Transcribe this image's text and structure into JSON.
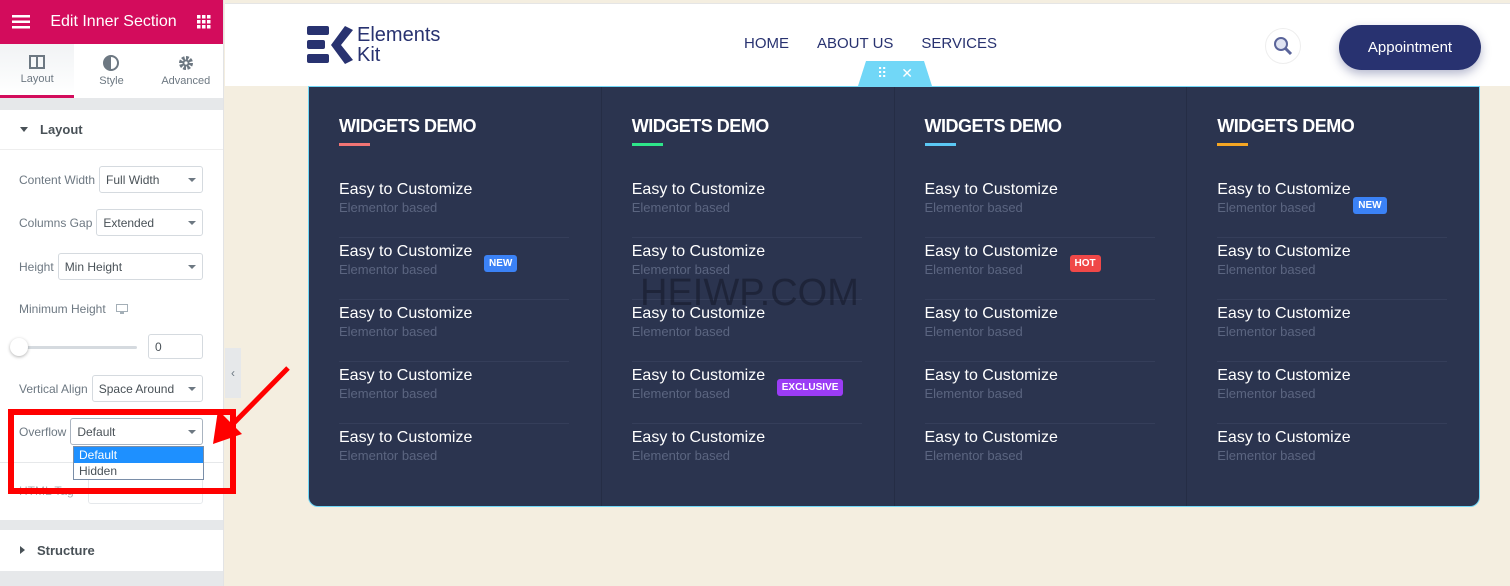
{
  "sidebar": {
    "title": "Edit Inner Section",
    "tabs": [
      {
        "label": "Layout",
        "icon": "columns-icon"
      },
      {
        "label": "Style",
        "icon": "contrast-icon"
      },
      {
        "label": "Advanced",
        "icon": "gear-icon"
      }
    ],
    "section_layout": "Layout",
    "controls": {
      "content_width": {
        "label": "Content Width",
        "value": "Full Width"
      },
      "columns_gap": {
        "label": "Columns Gap",
        "value": "Extended"
      },
      "height": {
        "label": "Height",
        "value": "Min Height"
      },
      "min_height": {
        "label": "Minimum Height",
        "value": "0"
      },
      "vertical_align": {
        "label": "Vertical Align",
        "value": "Space Around"
      },
      "overflow": {
        "label": "Overflow",
        "value": "Default",
        "options": [
          "Default",
          "Hidden"
        ]
      },
      "html_tag": {
        "label": "HTML Tag"
      }
    },
    "section_structure": "Structure"
  },
  "header": {
    "logo": "Elements Kit",
    "logo_lines": [
      "Elements",
      "Kit"
    ],
    "nav": [
      "HOME",
      "ABOUT US",
      "SERVICES"
    ],
    "appointment": "Appointment"
  },
  "menu": {
    "columns": [
      {
        "heading": "WIDGETS DEMO",
        "accent": "#f27474",
        "items": [
          {
            "title": "Easy to Customize",
            "sub": "Elementor based"
          },
          {
            "title": "Easy to Customize",
            "sub": "Elementor based",
            "badge": "NEW"
          },
          {
            "title": "Easy to Customize",
            "sub": "Elementor based"
          },
          {
            "title": "Easy to Customize",
            "sub": "Elementor based"
          },
          {
            "title": "Easy to Customize",
            "sub": "Elementor based"
          }
        ]
      },
      {
        "heading": "WIDGETS DEMO",
        "accent": "#2ee68a",
        "items": [
          {
            "title": "Easy to Customize",
            "sub": "Elementor based"
          },
          {
            "title": "Easy to Customize",
            "sub": "Elementor based"
          },
          {
            "title": "Easy to Customize",
            "sub": "Elementor based"
          },
          {
            "title": "Easy to Customize",
            "sub": "Elementor based",
            "badge": "EXCLUSIVE"
          },
          {
            "title": "Easy to Customize",
            "sub": "Elementor based"
          }
        ]
      },
      {
        "heading": "WIDGETS DEMO",
        "accent": "#5bc8f5",
        "items": [
          {
            "title": "Easy to Customize",
            "sub": "Elementor based"
          },
          {
            "title": "Easy to Customize",
            "sub": "Elementor based",
            "badge": "HOT"
          },
          {
            "title": "Easy to Customize",
            "sub": "Elementor based"
          },
          {
            "title": "Easy to Customize",
            "sub": "Elementor based"
          },
          {
            "title": "Easy to Customize",
            "sub": "Elementor based"
          }
        ]
      },
      {
        "heading": "WIDGETS DEMO",
        "accent": "#f5a623",
        "items": [
          {
            "title": "Easy to Customize",
            "sub": "Elementor based",
            "badge": "NEW"
          },
          {
            "title": "Easy to Customize",
            "sub": "Elementor based"
          },
          {
            "title": "Easy to Customize",
            "sub": "Elementor based"
          },
          {
            "title": "Easy to Customize",
            "sub": "Elementor based"
          },
          {
            "title": "Easy to Customize",
            "sub": "Elementor based"
          }
        ]
      }
    ]
  },
  "badge_colors": {
    "NEW": "#3b82f6",
    "HOT": "#f04848",
    "EXCLUSIVE": "#9b3cf5"
  },
  "watermark": "HEIWP.COM",
  "colors": {
    "brand": "#d30c5c",
    "nav": "#283270",
    "menu_bg": "#2b344f",
    "annotation": "#ff0000"
  },
  "state": {
    "active_tab": "Layout",
    "overflow_dropdown_open": true,
    "highlighted_option": "Default",
    "min_height_slider": 0
  }
}
